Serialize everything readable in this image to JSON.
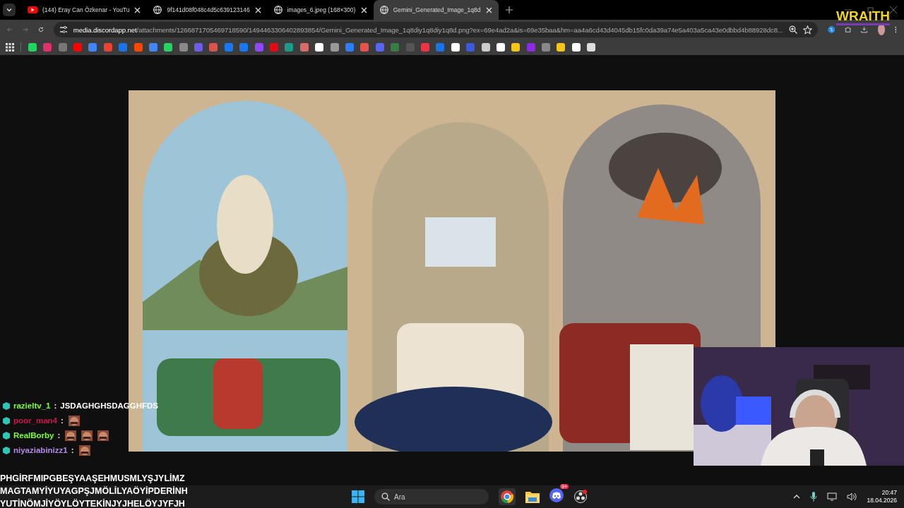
{
  "tabs": [
    {
      "kind": "youtube",
      "title": "(144) Eray Can Özkenar - YouTu",
      "selected": false
    },
    {
      "kind": "globe",
      "title": "9f141d08f048c4d5c639123146",
      "selected": false
    },
    {
      "kind": "globe",
      "title": "images_6.jpeg (168×300)",
      "selected": false
    },
    {
      "kind": "globe",
      "title": "Gemini_Generated_Image_1q8d",
      "selected": true
    }
  ],
  "address": {
    "host": "media.discordapp.net",
    "path": "/attachments/1266871705469718590/1494463306402893854/Gemini_Generated_Image_1q8diy1q8diy1q8d.png?ex=69e4ad2a&is=69e35baa&hm=aa4a6cd43d4045db15fc0da39a74e5a403a5ca43e0dbbd4b88928dc8..."
  },
  "overlay_logo": "WRAITH",
  "chat": [
    {
      "user": "razieltv_1",
      "color": "#7cfc3c",
      "separator": ":",
      "message": "JSDAGHGHSDAGGHFDS"
    },
    {
      "user": "poor_man4",
      "color": "#c8194a",
      "separator": ":"
    },
    {
      "user": "RealBorby",
      "color": "#7cfc3c",
      "separator": ":"
    },
    {
      "user": "niyaziabinizz1",
      "color": "#b68ce8",
      "separator": ":"
    }
  ],
  "ticker": [
    "PHGİRFMIPGBEŞYAAŞEHMUSMLYŞJYLİMZ",
    "MAGTAMYİYUYAGPŞJMÖLİLYAÖYİPDERİNH",
    "YUTİNÖMJİYÖYLÖYTEKİNJYJHELÖYJYFJH"
  ],
  "taskbar": {
    "search_placeholder": "Ara",
    "discord_badge": "9+",
    "time": "20:47",
    "date": "18.04.2026"
  }
}
